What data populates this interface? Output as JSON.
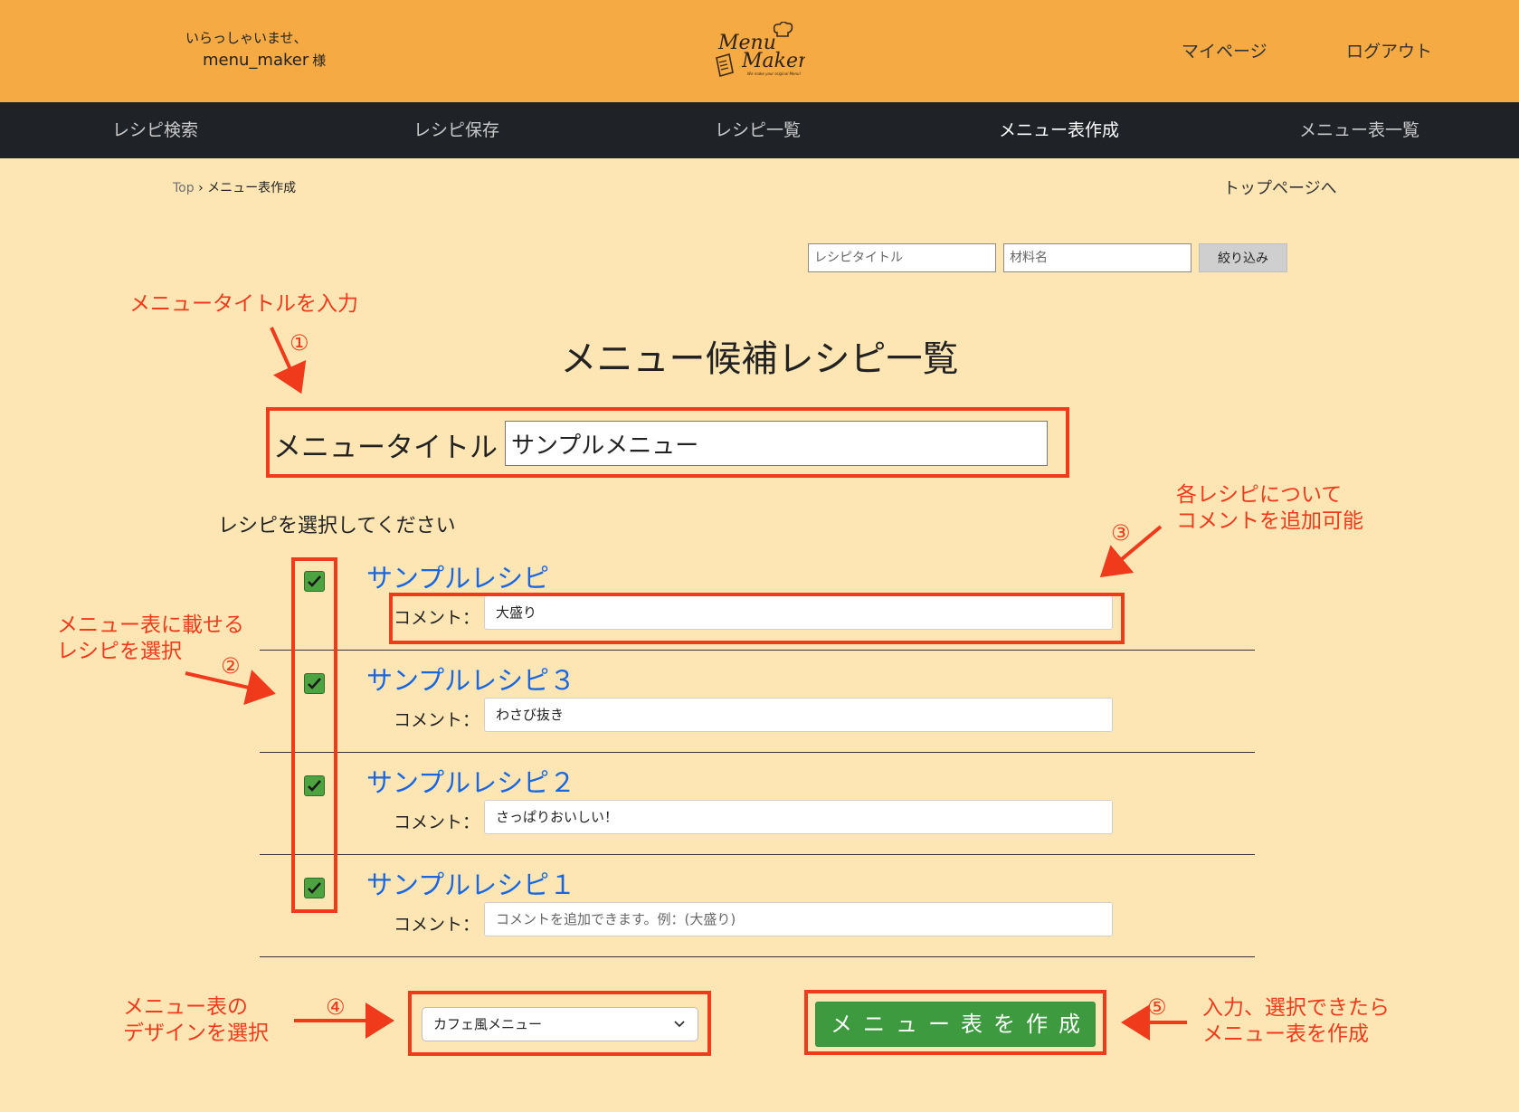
{
  "header": {
    "greeting_line1": "いらっしゃいませ、",
    "username": "menu_maker",
    "honorific": "様",
    "logo_text_top": "Menu",
    "logo_text_bottom": "Maker",
    "logo_tagline": "We make your original Menu!",
    "mypage_label": "マイページ",
    "logout_label": "ログアウト",
    "background_color": "#f5aa44"
  },
  "nav": {
    "items": [
      {
        "label": "レシピ検索"
      },
      {
        "label": "レシピ保存"
      },
      {
        "label": "レシピ一覧"
      },
      {
        "label": "メニュー表作成"
      },
      {
        "label": "メニュー表一覧"
      }
    ],
    "active": "メニュー表作成",
    "background_color": "#1f2227"
  },
  "breadcrumb": {
    "top": "Top",
    "separator": "›",
    "current": "メニュー表作成"
  },
  "top_page_link": "トップページへ",
  "filter": {
    "title_placeholder": "レシピタイトル",
    "ingredient_placeholder": "材料名",
    "button_label": "絞り込み"
  },
  "page_title": "メニュー候補レシピ一覧",
  "menu_title": {
    "label": "メニュータイトル",
    "value": "サンプルメニュー"
  },
  "select_prompt": "レシピを選択してください",
  "recipes": [
    {
      "name": "サンプルレシピ",
      "checked": true,
      "comment_label": "コメント：",
      "comment": "大盛り"
    },
    {
      "name": "サンプルレシピ３",
      "checked": true,
      "comment_label": "コメント：",
      "comment": "わさび抜き"
    },
    {
      "name": "サンプルレシピ２",
      "checked": true,
      "comment_label": "コメント：",
      "comment": "さっぱりおいしい！"
    },
    {
      "name": "サンプルレシピ１",
      "checked": true,
      "comment_label": "コメント：",
      "comment": ""
    }
  ],
  "comment_placeholder": "コメントを追加できます。例：(大盛り)",
  "design_select": {
    "selected": "カフェ風メニュー"
  },
  "create_button_label": "メニュー表を作成",
  "annotations": {
    "menu_title_hint": "メニュータイトルを入力",
    "num1": "①",
    "select_recipe_hint": "メニュー表に載せる\nレシピを選択",
    "num2": "②",
    "comment_hint": "各レシピについて\nコメントを追加可能",
    "num3": "③",
    "design_hint": "メニュー表の\nデザインを選択",
    "num4": "④",
    "create_hint": "入力、選択できたら\nメニュー表を作成",
    "num5": "⑤",
    "color": "#ef3a1c"
  },
  "colors": {
    "page_background": "#fee6b4",
    "recipe_link": "#1866e0",
    "checkbox": "#4ea341",
    "create_button": "#3e9a3e"
  }
}
